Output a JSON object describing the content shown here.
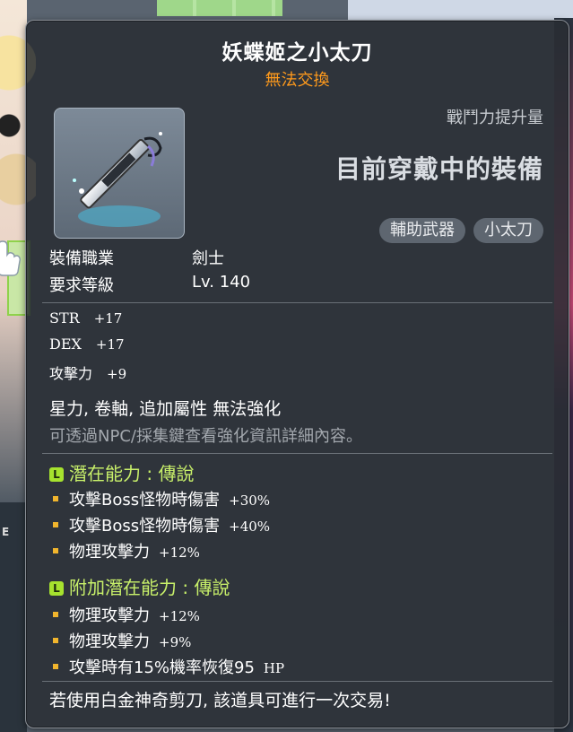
{
  "item": {
    "name": "妖蝶姬之小太刀",
    "trade_status": "無法交換",
    "power_label": "戰鬥力提升量",
    "wearing_label": "目前穿戴中的裝備",
    "tags": [
      "輔助武器",
      "小太刀"
    ]
  },
  "requirements": {
    "job_label": "裝備職業",
    "job_value": "劍士",
    "level_label": "要求等級",
    "level_value": "Lv. 140"
  },
  "stats": [
    {
      "name": "STR",
      "value": "+17"
    },
    {
      "name": "DEX",
      "value": "+17"
    },
    {
      "name": "攻擊力",
      "value": "+9"
    }
  ],
  "no_enhance_text": "星力, 卷軸, 追加屬性 無法強化",
  "hint_text": "可透過NPC/採集鍵查看強化資訊詳細內容。",
  "potential": {
    "title": "潛在能力 : 傳說",
    "badge": "L",
    "lines": [
      {
        "text": "攻擊Boss怪物時傷害",
        "value": "+30%"
      },
      {
        "text": "攻擊Boss怪物時傷害",
        "value": "+40%"
      },
      {
        "text": "物理攻擊力",
        "value": "+12%"
      }
    ]
  },
  "additional_potential": {
    "title": "附加潛在能力 : 傳說",
    "badge": "L",
    "lines": [
      {
        "text": "物理攻擊力",
        "value": "+12%"
      },
      {
        "text": "物理攻擊力",
        "value": "+9%"
      },
      {
        "text": "攻擊時有15%機率恢復95",
        "value": "HP"
      }
    ]
  },
  "footer_text": "若使用白金神奇剪刀, 該道具可進行一次交易!",
  "colors": {
    "trade_orange": "#ff9a1c",
    "potential_green": "#c8f06a",
    "bullet_gold": "#f1b52d",
    "hint_gray": "#a3a8ae"
  }
}
